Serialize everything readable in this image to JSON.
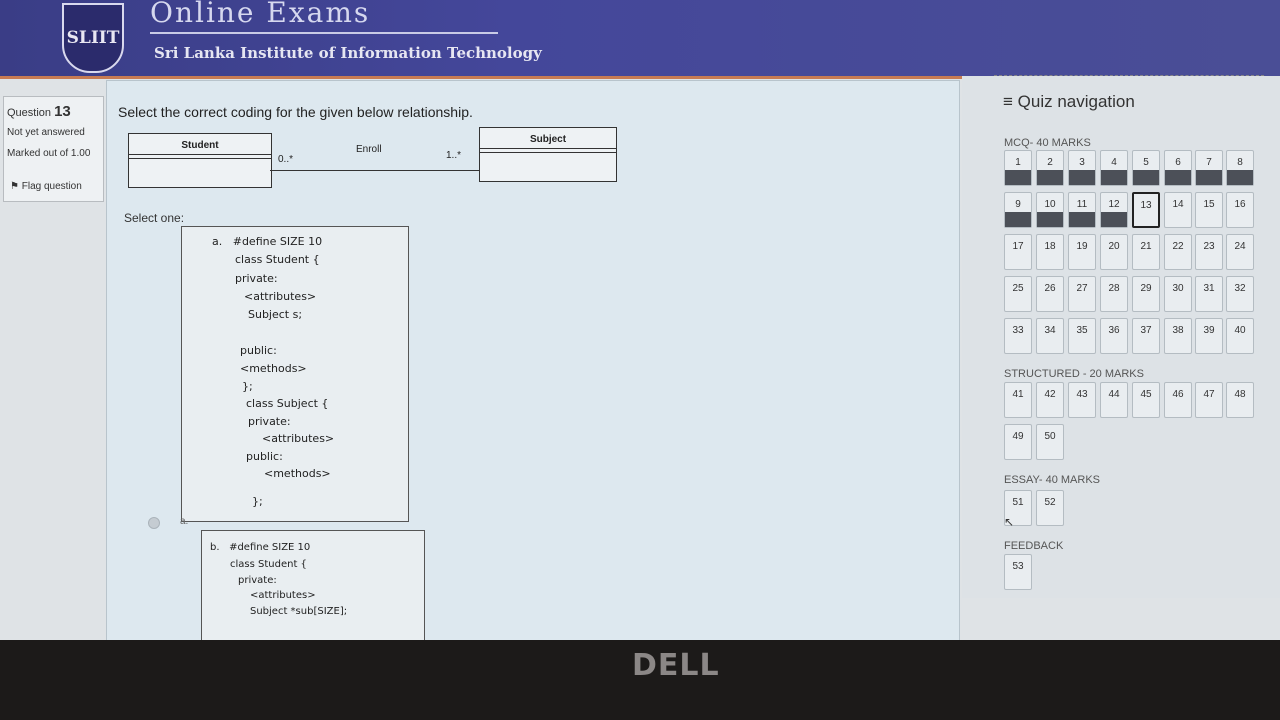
{
  "header": {
    "logo_text": "SLIIT",
    "title": "Online Exams",
    "subtitle": "Sri Lanka Institute of Information Technology"
  },
  "question_info": {
    "label": "Question",
    "number": "13",
    "status": "Not yet answered",
    "marked_out_of": "Marked out of 1.00",
    "flag": "Flag question"
  },
  "question": {
    "text": "Select the correct coding for the given below relationship.",
    "uml": {
      "left_class": "Student",
      "right_class": "Subject",
      "association": "Enroll",
      "left_multiplicity": "0..*",
      "right_multiplicity": "1..*"
    },
    "select_one": "Select one:",
    "option_a_lines": [
      "a.   #define SIZE 10",
      "class Student {",
      "private:",
      "<attributes>",
      "Subject s;",
      "public:",
      "<methods>",
      "};",
      "class Subject {",
      "private:",
      "<attributes>",
      "public:",
      "<methods>",
      "};"
    ],
    "option_a_radio_letter": "a.",
    "option_b_lines": [
      "b.   #define SIZE 10",
      "class Student {",
      "private:",
      "<attributes>",
      "Subject *sub[SIZE];"
    ]
  },
  "navigation": {
    "title": "Quiz navigation",
    "sections": [
      "MCQ- 40 MARKS",
      "STRUCTURED - 20 MARKS",
      "ESSAY- 40 MARKS",
      "FEEDBACK"
    ],
    "current": 13,
    "answered": [
      1,
      2,
      3,
      4,
      5,
      6,
      7,
      8,
      9,
      10,
      11,
      12
    ]
  },
  "monitor_brand": "DELL"
}
